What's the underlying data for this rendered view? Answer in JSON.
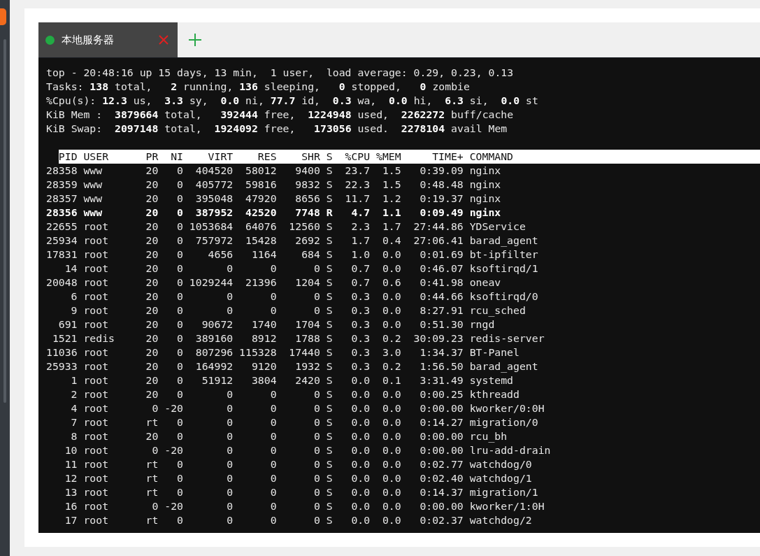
{
  "tabs": [
    {
      "label": "本地服务器",
      "selected": true,
      "color": "#22aa44"
    }
  ],
  "terminal": {
    "summary": [
      "top - 20:48:16 up 15 days, 13 min,  1 user,  load average: 0.29, 0.23, 0.13",
      "Tasks: **138** total,   **2** running, **136** sleeping,   **0** stopped,   **0** zombie",
      "%Cpu(s): **12.3** us,  **3.3** sy,  **0.0** ni, **77.7** id,  **0.3** wa,  **0.0** hi,  **6.3** si,  **0.0** st",
      "KiB Mem :  **3879664** total,   **392444** free,  **1224948** used,  **2262272** buff/cache",
      "KiB Swap:  **2097148** total,  **1924092** free,   **173056** used.  **2278104** avail Mem"
    ],
    "columns": [
      "PID",
      "USER",
      "PR",
      "NI",
      "VIRT",
      "RES",
      "SHR",
      "S",
      "%CPU",
      "%MEM",
      "TIME+",
      "COMMAND"
    ],
    "rows": [
      {
        "highlighted": false,
        "cells": [
          "28358",
          "www",
          "20",
          "0",
          "404520",
          "58012",
          "9400",
          "S",
          "23.7",
          "1.5",
          "0:39.09",
          "nginx"
        ]
      },
      {
        "highlighted": false,
        "cells": [
          "28359",
          "www",
          "20",
          "0",
          "405772",
          "59816",
          "9832",
          "S",
          "22.3",
          "1.5",
          "0:48.48",
          "nginx"
        ]
      },
      {
        "highlighted": false,
        "cells": [
          "28357",
          "www",
          "20",
          "0",
          "395048",
          "47920",
          "8656",
          "S",
          "11.7",
          "1.2",
          "0:19.37",
          "nginx"
        ]
      },
      {
        "highlighted": true,
        "cells": [
          "28356",
          "www",
          "20",
          "0",
          "387952",
          "42520",
          "7748",
          "R",
          "4.7",
          "1.1",
          "0:09.49",
          "nginx"
        ]
      },
      {
        "highlighted": false,
        "cells": [
          "22655",
          "root",
          "20",
          "0",
          "1053684",
          "64076",
          "12560",
          "S",
          "2.3",
          "1.7",
          "27:44.86",
          "YDService"
        ]
      },
      {
        "highlighted": false,
        "cells": [
          "25934",
          "root",
          "20",
          "0",
          "757972",
          "15428",
          "2692",
          "S",
          "1.7",
          "0.4",
          "27:06.41",
          "barad_agent"
        ]
      },
      {
        "highlighted": false,
        "cells": [
          "17831",
          "root",
          "20",
          "0",
          "4656",
          "1164",
          "684",
          "S",
          "1.0",
          "0.0",
          "0:01.69",
          "bt-ipfilter"
        ]
      },
      {
        "highlighted": false,
        "cells": [
          "14",
          "root",
          "20",
          "0",
          "0",
          "0",
          "0",
          "S",
          "0.7",
          "0.0",
          "0:46.07",
          "ksoftirqd/1"
        ]
      },
      {
        "highlighted": false,
        "cells": [
          "20048",
          "root",
          "20",
          "0",
          "1029244",
          "21396",
          "1204",
          "S",
          "0.7",
          "0.6",
          "0:41.98",
          "oneav"
        ]
      },
      {
        "highlighted": false,
        "cells": [
          "6",
          "root",
          "20",
          "0",
          "0",
          "0",
          "0",
          "S",
          "0.3",
          "0.0",
          "0:44.66",
          "ksoftirqd/0"
        ]
      },
      {
        "highlighted": false,
        "cells": [
          "9",
          "root",
          "20",
          "0",
          "0",
          "0",
          "0",
          "S",
          "0.3",
          "0.0",
          "8:27.91",
          "rcu_sched"
        ]
      },
      {
        "highlighted": false,
        "cells": [
          "691",
          "root",
          "20",
          "0",
          "90672",
          "1740",
          "1704",
          "S",
          "0.3",
          "0.0",
          "0:51.30",
          "rngd"
        ]
      },
      {
        "highlighted": false,
        "cells": [
          "1521",
          "redis",
          "20",
          "0",
          "389160",
          "8912",
          "1788",
          "S",
          "0.3",
          "0.2",
          "30:09.23",
          "redis-server"
        ]
      },
      {
        "highlighted": false,
        "cells": [
          "11036",
          "root",
          "20",
          "0",
          "807296",
          "115328",
          "17440",
          "S",
          "0.3",
          "3.0",
          "1:34.37",
          "BT-Panel"
        ]
      },
      {
        "highlighted": false,
        "cells": [
          "25933",
          "root",
          "20",
          "0",
          "164992",
          "9120",
          "1932",
          "S",
          "0.3",
          "0.2",
          "1:56.50",
          "barad_agent"
        ]
      },
      {
        "highlighted": false,
        "cells": [
          "1",
          "root",
          "20",
          "0",
          "51912",
          "3804",
          "2420",
          "S",
          "0.0",
          "0.1",
          "3:31.49",
          "systemd"
        ]
      },
      {
        "highlighted": false,
        "cells": [
          "2",
          "root",
          "20",
          "0",
          "0",
          "0",
          "0",
          "S",
          "0.0",
          "0.0",
          "0:00.25",
          "kthreadd"
        ]
      },
      {
        "highlighted": false,
        "cells": [
          "4",
          "root",
          "0",
          "-20",
          "0",
          "0",
          "0",
          "S",
          "0.0",
          "0.0",
          "0:00.00",
          "kworker/0:0H"
        ]
      },
      {
        "highlighted": false,
        "cells": [
          "7",
          "root",
          "rt",
          "0",
          "0",
          "0",
          "0",
          "S",
          "0.0",
          "0.0",
          "0:14.27",
          "migration/0"
        ]
      },
      {
        "highlighted": false,
        "cells": [
          "8",
          "root",
          "20",
          "0",
          "0",
          "0",
          "0",
          "S",
          "0.0",
          "0.0",
          "0:00.00",
          "rcu_bh"
        ]
      },
      {
        "highlighted": false,
        "cells": [
          "10",
          "root",
          "0",
          "-20",
          "0",
          "0",
          "0",
          "S",
          "0.0",
          "0.0",
          "0:00.00",
          "lru-add-drain"
        ]
      },
      {
        "highlighted": false,
        "cells": [
          "11",
          "root",
          "rt",
          "0",
          "0",
          "0",
          "0",
          "S",
          "0.0",
          "0.0",
          "0:02.77",
          "watchdog/0"
        ]
      },
      {
        "highlighted": false,
        "cells": [
          "12",
          "root",
          "rt",
          "0",
          "0",
          "0",
          "0",
          "S",
          "0.0",
          "0.0",
          "0:02.40",
          "watchdog/1"
        ]
      },
      {
        "highlighted": false,
        "cells": [
          "13",
          "root",
          "rt",
          "0",
          "0",
          "0",
          "0",
          "S",
          "0.0",
          "0.0",
          "0:14.37",
          "migration/1"
        ]
      },
      {
        "highlighted": false,
        "cells": [
          "16",
          "root",
          "0",
          "-20",
          "0",
          "0",
          "0",
          "S",
          "0.0",
          "0.0",
          "0:00.00",
          "kworker/1:0H"
        ]
      },
      {
        "highlighted": false,
        "cells": [
          "17",
          "root",
          "rt",
          "0",
          "0",
          "0",
          "0",
          "S",
          "0.0",
          "0.0",
          "0:02.37",
          "watchdog/2"
        ]
      }
    ]
  }
}
